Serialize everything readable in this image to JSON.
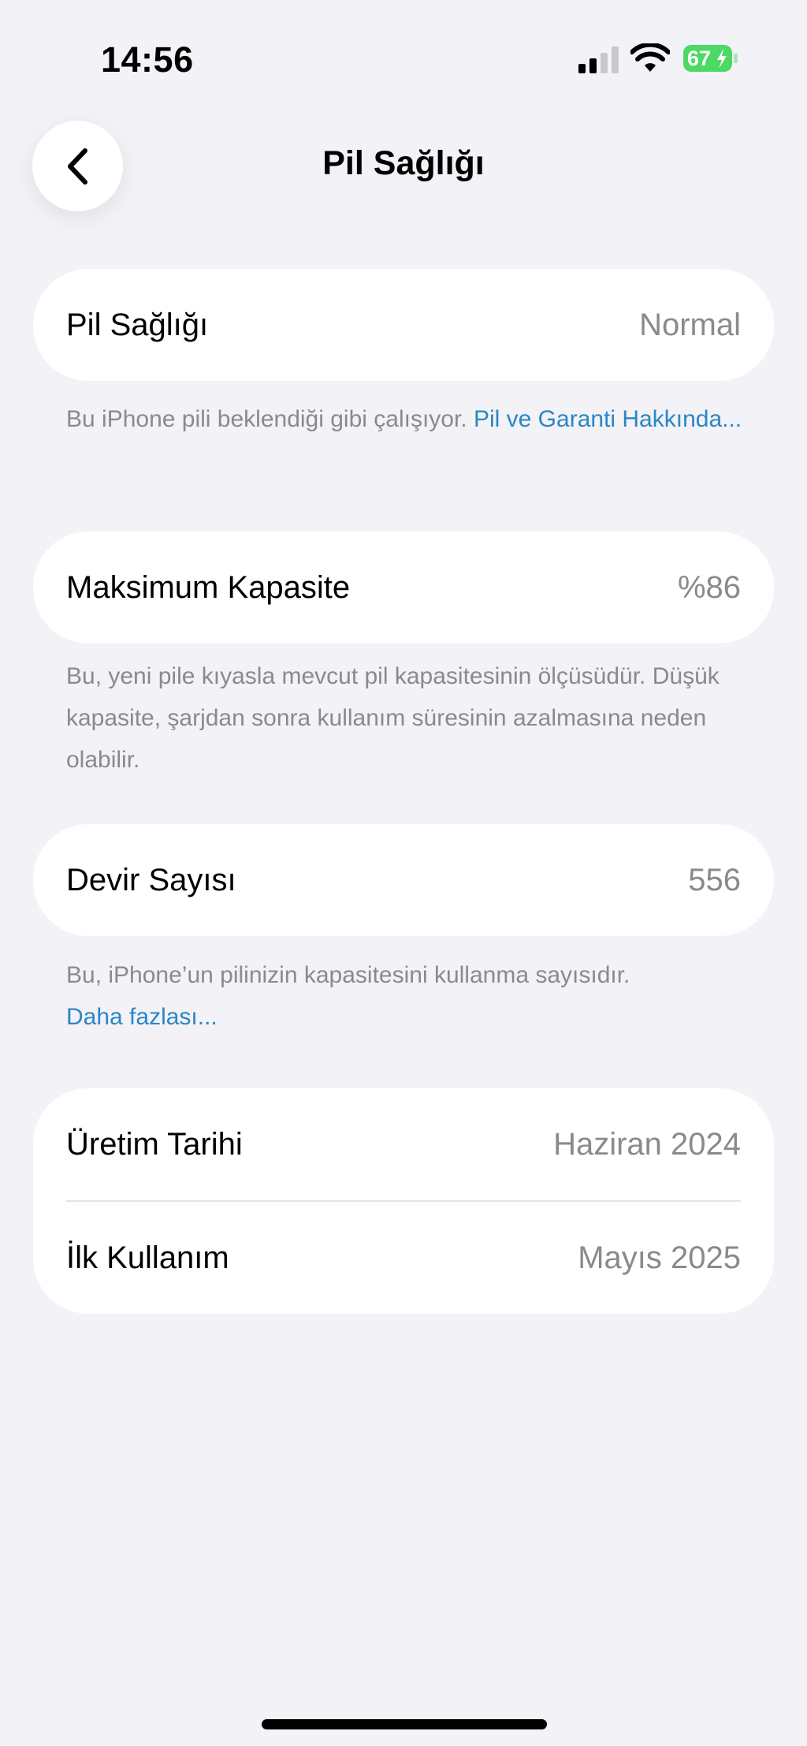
{
  "status_bar": {
    "time": "14:56",
    "battery_level": "67",
    "battery_color": "#4cd964",
    "signal_icon": "cellular-signal-icon",
    "wifi_icon": "wifi-icon"
  },
  "nav": {
    "title": "Pil Sağlığı",
    "back_icon": "chevron-left-icon"
  },
  "battery_health": {
    "label": "Pil Sağlığı",
    "value": "Normal",
    "footnote_text": "Bu iPhone pili beklendiği gibi çalışıyor. ",
    "footnote_link": "Pil ve Garanti Hakkında..."
  },
  "max_capacity": {
    "label": "Maksimum Kapasite",
    "value": "%86",
    "footnote_text": "Bu, yeni pile kıyasla mevcut pil kapasitesinin ölçüsüdür. Düşük kapasite, şarjdan sonra kullanım süresinin azalmasına neden olabilir."
  },
  "cycle_count": {
    "label": "Devir Sayısı",
    "value": "556",
    "footnote_text": "Bu, iPhone’un pilinizin kapasitesini kullanma sayısıdır. ",
    "footnote_link": "Daha fazlası..."
  },
  "dates": {
    "manufacture_label": "Üretim Tarihi",
    "manufacture_value": "Haziran 2024",
    "first_use_label": "İlk Kullanım",
    "first_use_value": "Mayıs 2025"
  },
  "colors": {
    "background": "#f2f2f7",
    "link": "#2b86c5",
    "secondary_text": "#8a8a8e"
  }
}
